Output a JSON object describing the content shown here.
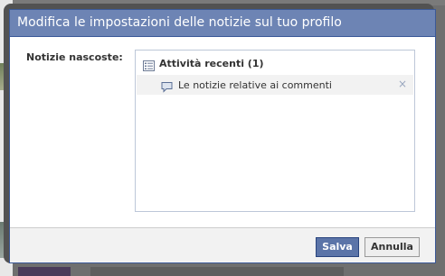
{
  "dialog": {
    "title": "Modifica le impostazioni delle notizie sul tuo profilo"
  },
  "hidden_stories": {
    "label": "Notizie nascoste:",
    "section": {
      "icon": "recent-activity-icon",
      "title": "Attività recenti (1)"
    },
    "items": [
      {
        "icon": "comment-icon",
        "label": "Le notizie relative ai commenti",
        "remove_glyph": "×"
      }
    ]
  },
  "footer": {
    "save_label": "Salva",
    "cancel_label": "Annulla"
  },
  "colors": {
    "header_bg": "#6d84b4",
    "header_border": "#3b5998",
    "save_bg": "#5b74a8",
    "footer_bg": "#f2f2f2"
  }
}
